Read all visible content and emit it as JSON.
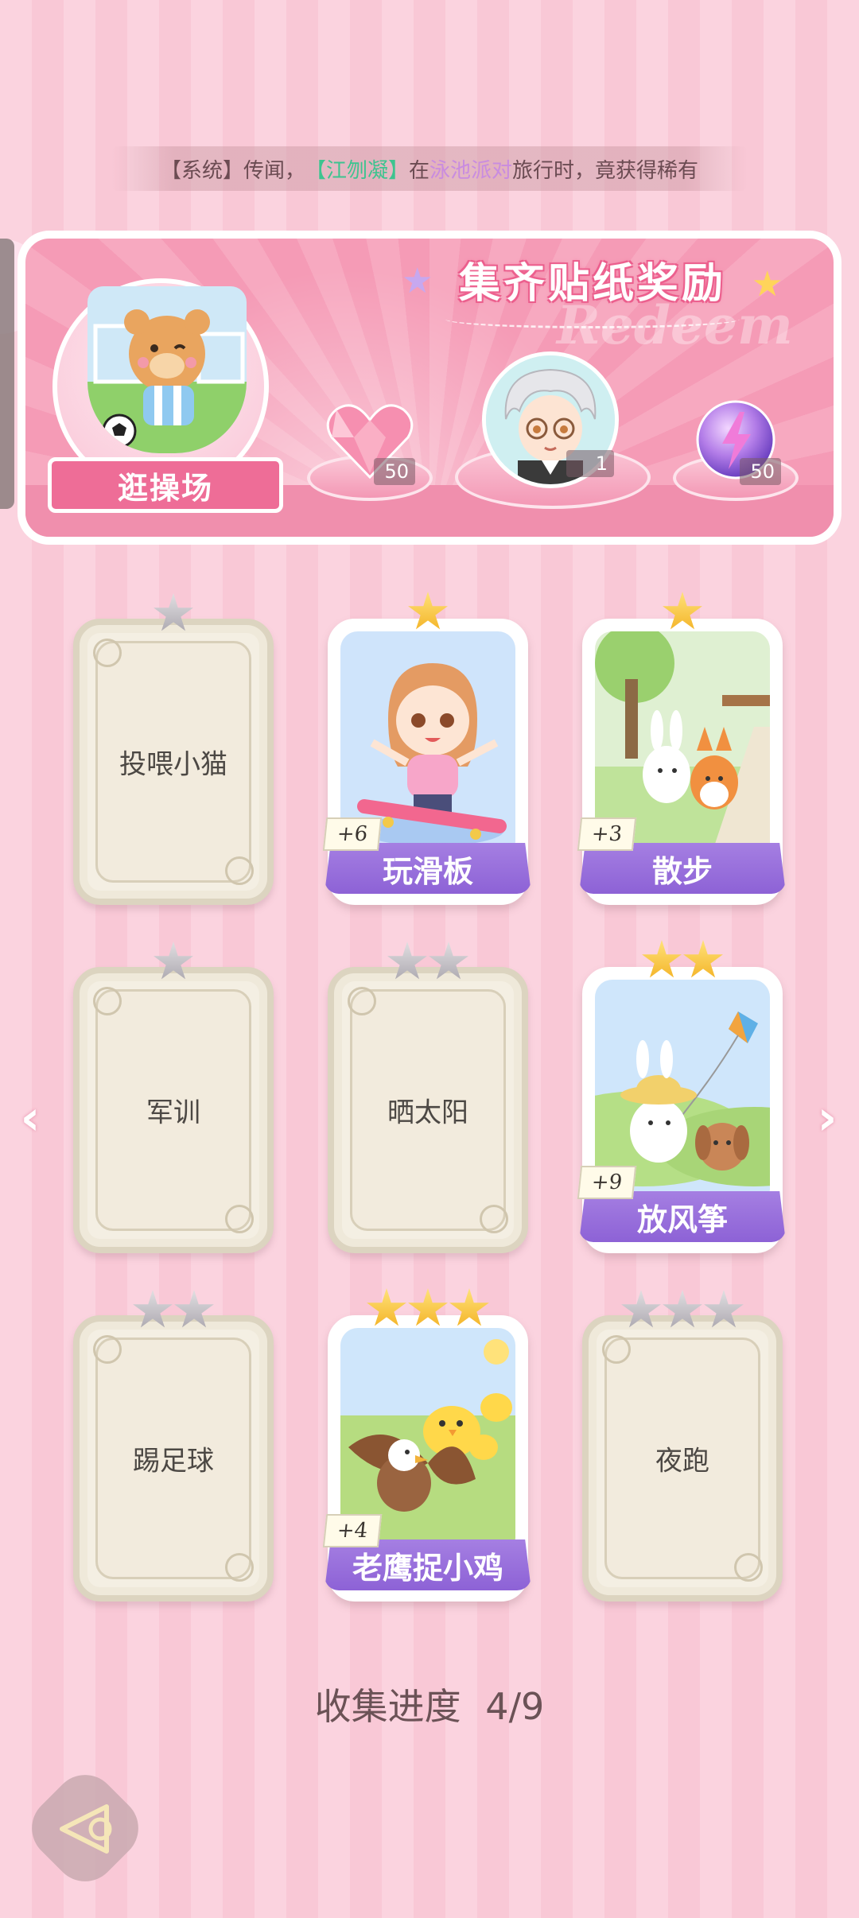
{
  "marquee": {
    "prefix": "【系统】传闻，",
    "player": "【江刎凝】",
    "middle": "在",
    "location": "泳池派对",
    "suffix": "旅行时，竟获得稀有"
  },
  "banner": {
    "title": "集齐贴纸奖励",
    "watermark": "Redeem",
    "location_label": "逛操场",
    "rewards": [
      {
        "icon": "pink-heart-gem-icon",
        "count": "50"
      },
      {
        "icon": "character-avatar-icon",
        "count": "1"
      },
      {
        "icon": "purple-energy-orb-icon",
        "count": "50"
      }
    ]
  },
  "cards": [
    {
      "name": "投喂小猫",
      "unlocked": false,
      "stars": 1,
      "star_color": "grey"
    },
    {
      "name": "玩滑板",
      "unlocked": true,
      "stars": 1,
      "star_color": "gold",
      "plus": "+6"
    },
    {
      "name": "散步",
      "unlocked": true,
      "stars": 1,
      "star_color": "gold",
      "plus": "+3"
    },
    {
      "name": "军训",
      "unlocked": false,
      "stars": 1,
      "star_color": "grey"
    },
    {
      "name": "晒太阳",
      "unlocked": false,
      "stars": 2,
      "star_color": "grey"
    },
    {
      "name": "放风筝",
      "unlocked": true,
      "stars": 2,
      "star_color": "gold",
      "plus": "+9"
    },
    {
      "name": "踢足球",
      "unlocked": false,
      "stars": 2,
      "star_color": "grey"
    },
    {
      "name": "老鹰捉小鸡",
      "unlocked": true,
      "stars": 3,
      "star_color": "gold",
      "plus": "+4"
    },
    {
      "name": "夜跑",
      "unlocked": false,
      "stars": 3,
      "star_color": "grey"
    }
  ],
  "progress": {
    "label": "收集进度",
    "value": "4/9"
  },
  "nav": {
    "left": "‹",
    "right": "›"
  }
}
